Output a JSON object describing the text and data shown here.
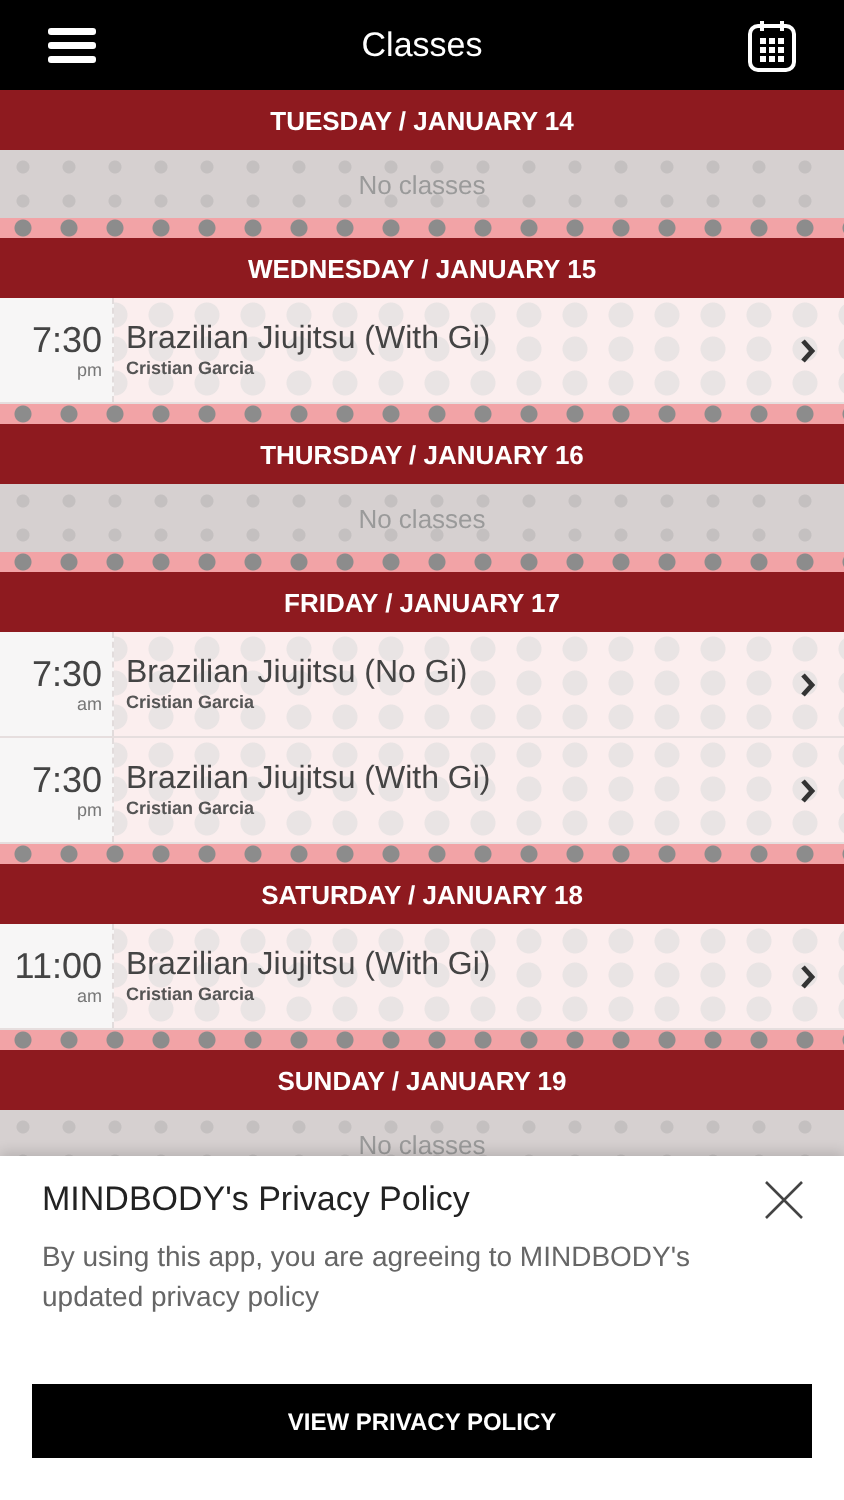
{
  "navbar": {
    "title": "Classes"
  },
  "days": [
    {
      "label": "TUESDAY / JANUARY 14",
      "empty_text": "No classes"
    },
    {
      "label": "WEDNESDAY / JANUARY 15",
      "classes": [
        {
          "time": "7:30",
          "period": "pm",
          "name": "Brazilian Jiujitsu (With Gi)",
          "instructor": "Cristian Garcia"
        }
      ]
    },
    {
      "label": "THURSDAY / JANUARY 16",
      "empty_text": "No classes"
    },
    {
      "label": "FRIDAY / JANUARY 17",
      "classes": [
        {
          "time": "7:30",
          "period": "am",
          "name": "Brazilian Jiujitsu (No Gi)",
          "instructor": "Cristian Garcia"
        },
        {
          "time": "7:30",
          "period": "pm",
          "name": "Brazilian Jiujitsu (With Gi)",
          "instructor": "Cristian Garcia"
        }
      ]
    },
    {
      "label": "SATURDAY / JANUARY 18",
      "classes": [
        {
          "time": "11:00",
          "period": "am",
          "name": "Brazilian Jiujitsu (With Gi)",
          "instructor": "Cristian Garcia"
        }
      ]
    },
    {
      "label": "SUNDAY / JANUARY 19",
      "empty_text": "No classes"
    }
  ],
  "privacy_popup": {
    "title": "MINDBODY's Privacy Policy",
    "message": "By using this app, you are agreeing to MINDBODY's updated privacy policy",
    "button": "VIEW PRIVACY POLICY"
  }
}
